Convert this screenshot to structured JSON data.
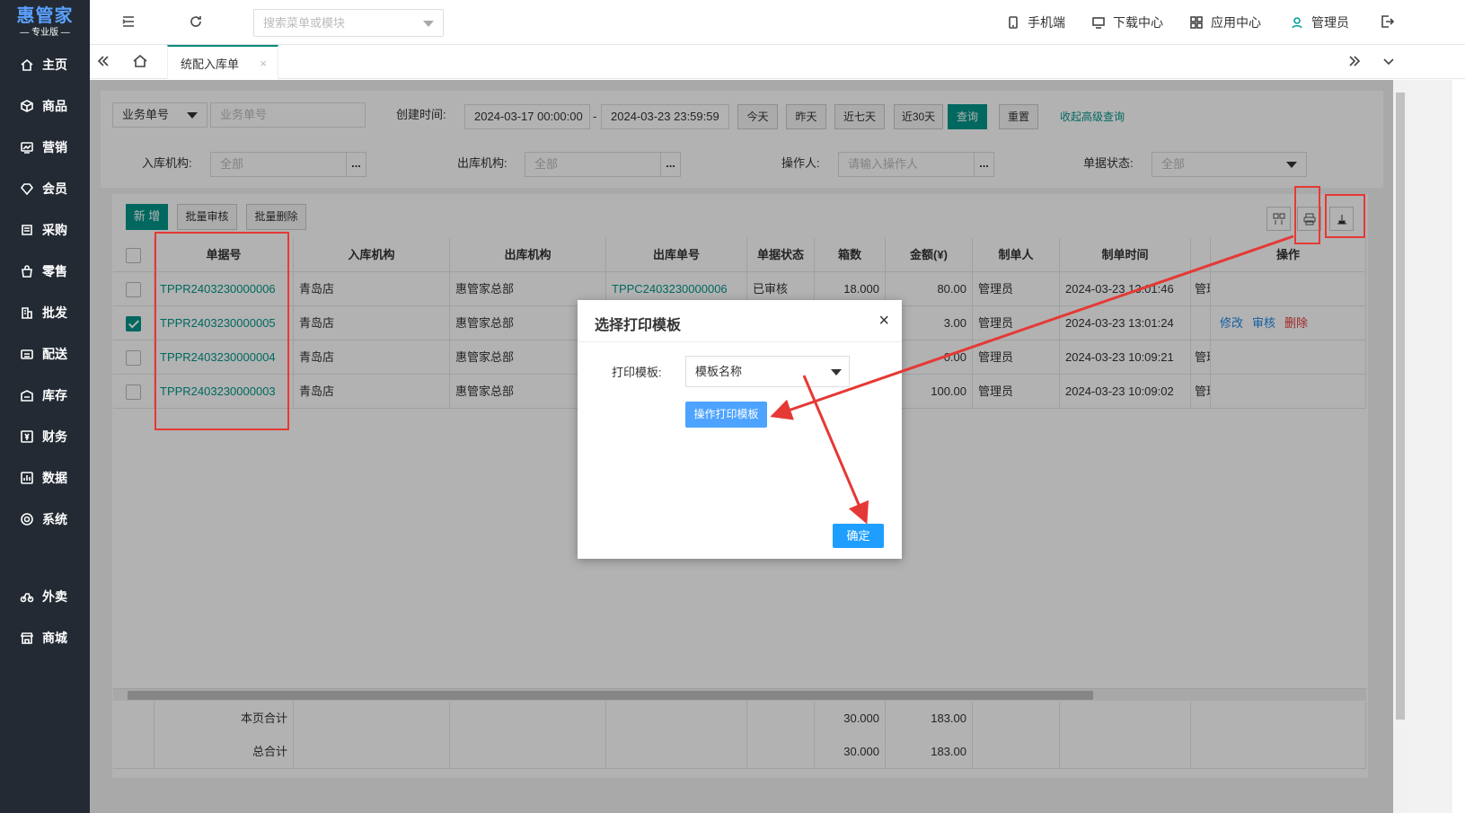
{
  "app": {
    "logo": "惠管家",
    "edition": "专业版"
  },
  "sidebar": {
    "items": [
      {
        "label": "主页",
        "icon": "home-icon"
      },
      {
        "label": "商品",
        "icon": "box-icon"
      },
      {
        "label": "营销",
        "icon": "chart-card-icon"
      },
      {
        "label": "会员",
        "icon": "heart-shield-icon"
      },
      {
        "label": "采购",
        "icon": "list-icon"
      },
      {
        "label": "零售",
        "icon": "shopping-bag-icon"
      },
      {
        "label": "批发",
        "icon": "building-icon"
      },
      {
        "label": "配送",
        "icon": "truck-icon"
      },
      {
        "label": "库存",
        "icon": "warehouse-icon"
      },
      {
        "label": "财务",
        "icon": "yen-icon"
      },
      {
        "label": "数据",
        "icon": "bar-chart-icon"
      },
      {
        "label": "系统",
        "icon": "settings-icon"
      },
      {
        "label": "外卖",
        "icon": "bike-icon"
      },
      {
        "label": "商城",
        "icon": "store-icon"
      }
    ]
  },
  "header": {
    "search_placeholder": "搜索菜单或模块",
    "mobile": "手机端",
    "download": "下载中心",
    "apps": "应用中心",
    "user": "管理员"
  },
  "tabs": {
    "active": "统配入库单",
    "close": "×"
  },
  "filters": {
    "field_select": "业务单号",
    "field_placeholder": "业务单号",
    "created_label": "创建时间:",
    "start": "2024-03-17 00:00:00",
    "dash": "-",
    "end": "2024-03-23 23:59:59",
    "today": "今天",
    "yesterday": "昨天",
    "week": "近七天",
    "month": "近30天",
    "query": "查询",
    "reset": "重置",
    "advanced": "收起高级查询",
    "in_org_label": "入库机构:",
    "in_org": "全部",
    "out_org_label": "出库机构:",
    "out_org": "全部",
    "operator_label": "操作人:",
    "operator_placeholder": "请输入操作人",
    "status_label": "单据状态:",
    "status": "全部",
    "dots": "..."
  },
  "toolbar": {
    "add": "新 增",
    "batch_audit": "批量审核",
    "batch_delete": "批量删除"
  },
  "table": {
    "headers": [
      "单据号",
      "入库机构",
      "出库机构",
      "出库单号",
      "单据状态",
      "箱数",
      "金额(¥)",
      "制单人",
      "制单时间",
      "操作"
    ],
    "rows": [
      {
        "checked": false,
        "no": "TPPR2403230000006",
        "in_org": "青岛店",
        "out_org": "惠管家总部",
        "out_no": "TPPC2403230000006",
        "status": "已审核",
        "boxes": "18.000",
        "amount": "80.00",
        "maker": "管理员",
        "time": "2024-03-23 13:01:46",
        "extra": "管理"
      },
      {
        "checked": true,
        "no": "TPPR2403230000005",
        "in_org": "青岛店",
        "out_org": "惠管家总部",
        "out_no": "",
        "status": "",
        "boxes": "",
        "amount": "3.00",
        "maker": "管理员",
        "time": "2024-03-23 13:01:24",
        "extra": ""
      },
      {
        "checked": false,
        "no": "TPPR2403230000004",
        "in_org": "青岛店",
        "out_org": "惠管家总部",
        "out_no": "",
        "status": "",
        "boxes": "",
        "amount": "0.00",
        "maker": "管理员",
        "time": "2024-03-23 10:09:21",
        "extra": "管理"
      },
      {
        "checked": false,
        "no": "TPPR2403230000003",
        "in_org": "青岛店",
        "out_org": "惠管家总部",
        "out_no": "",
        "status": "",
        "boxes": "",
        "amount": "100.00",
        "maker": "管理员",
        "time": "2024-03-23 10:09:02",
        "extra": "管理"
      }
    ],
    "actions": {
      "edit": "修改",
      "audit": "审核",
      "delete": "删除"
    },
    "page_total_label": "本页合计",
    "grand_total_label": "总合计",
    "page_boxes": "30.000",
    "page_amount": "183.00",
    "grand_boxes": "30.000",
    "grand_amount": "183.00"
  },
  "modal": {
    "title": "选择打印模板",
    "close": "×",
    "template_label": "打印模板:",
    "template_value": "模板名称",
    "operate_button": "操作打印模板",
    "confirm": "确定"
  },
  "colors": {
    "accent": "#009688",
    "sidebar": "#232a33",
    "annotation": "#e53935",
    "primary_button": "#1e9fff"
  }
}
